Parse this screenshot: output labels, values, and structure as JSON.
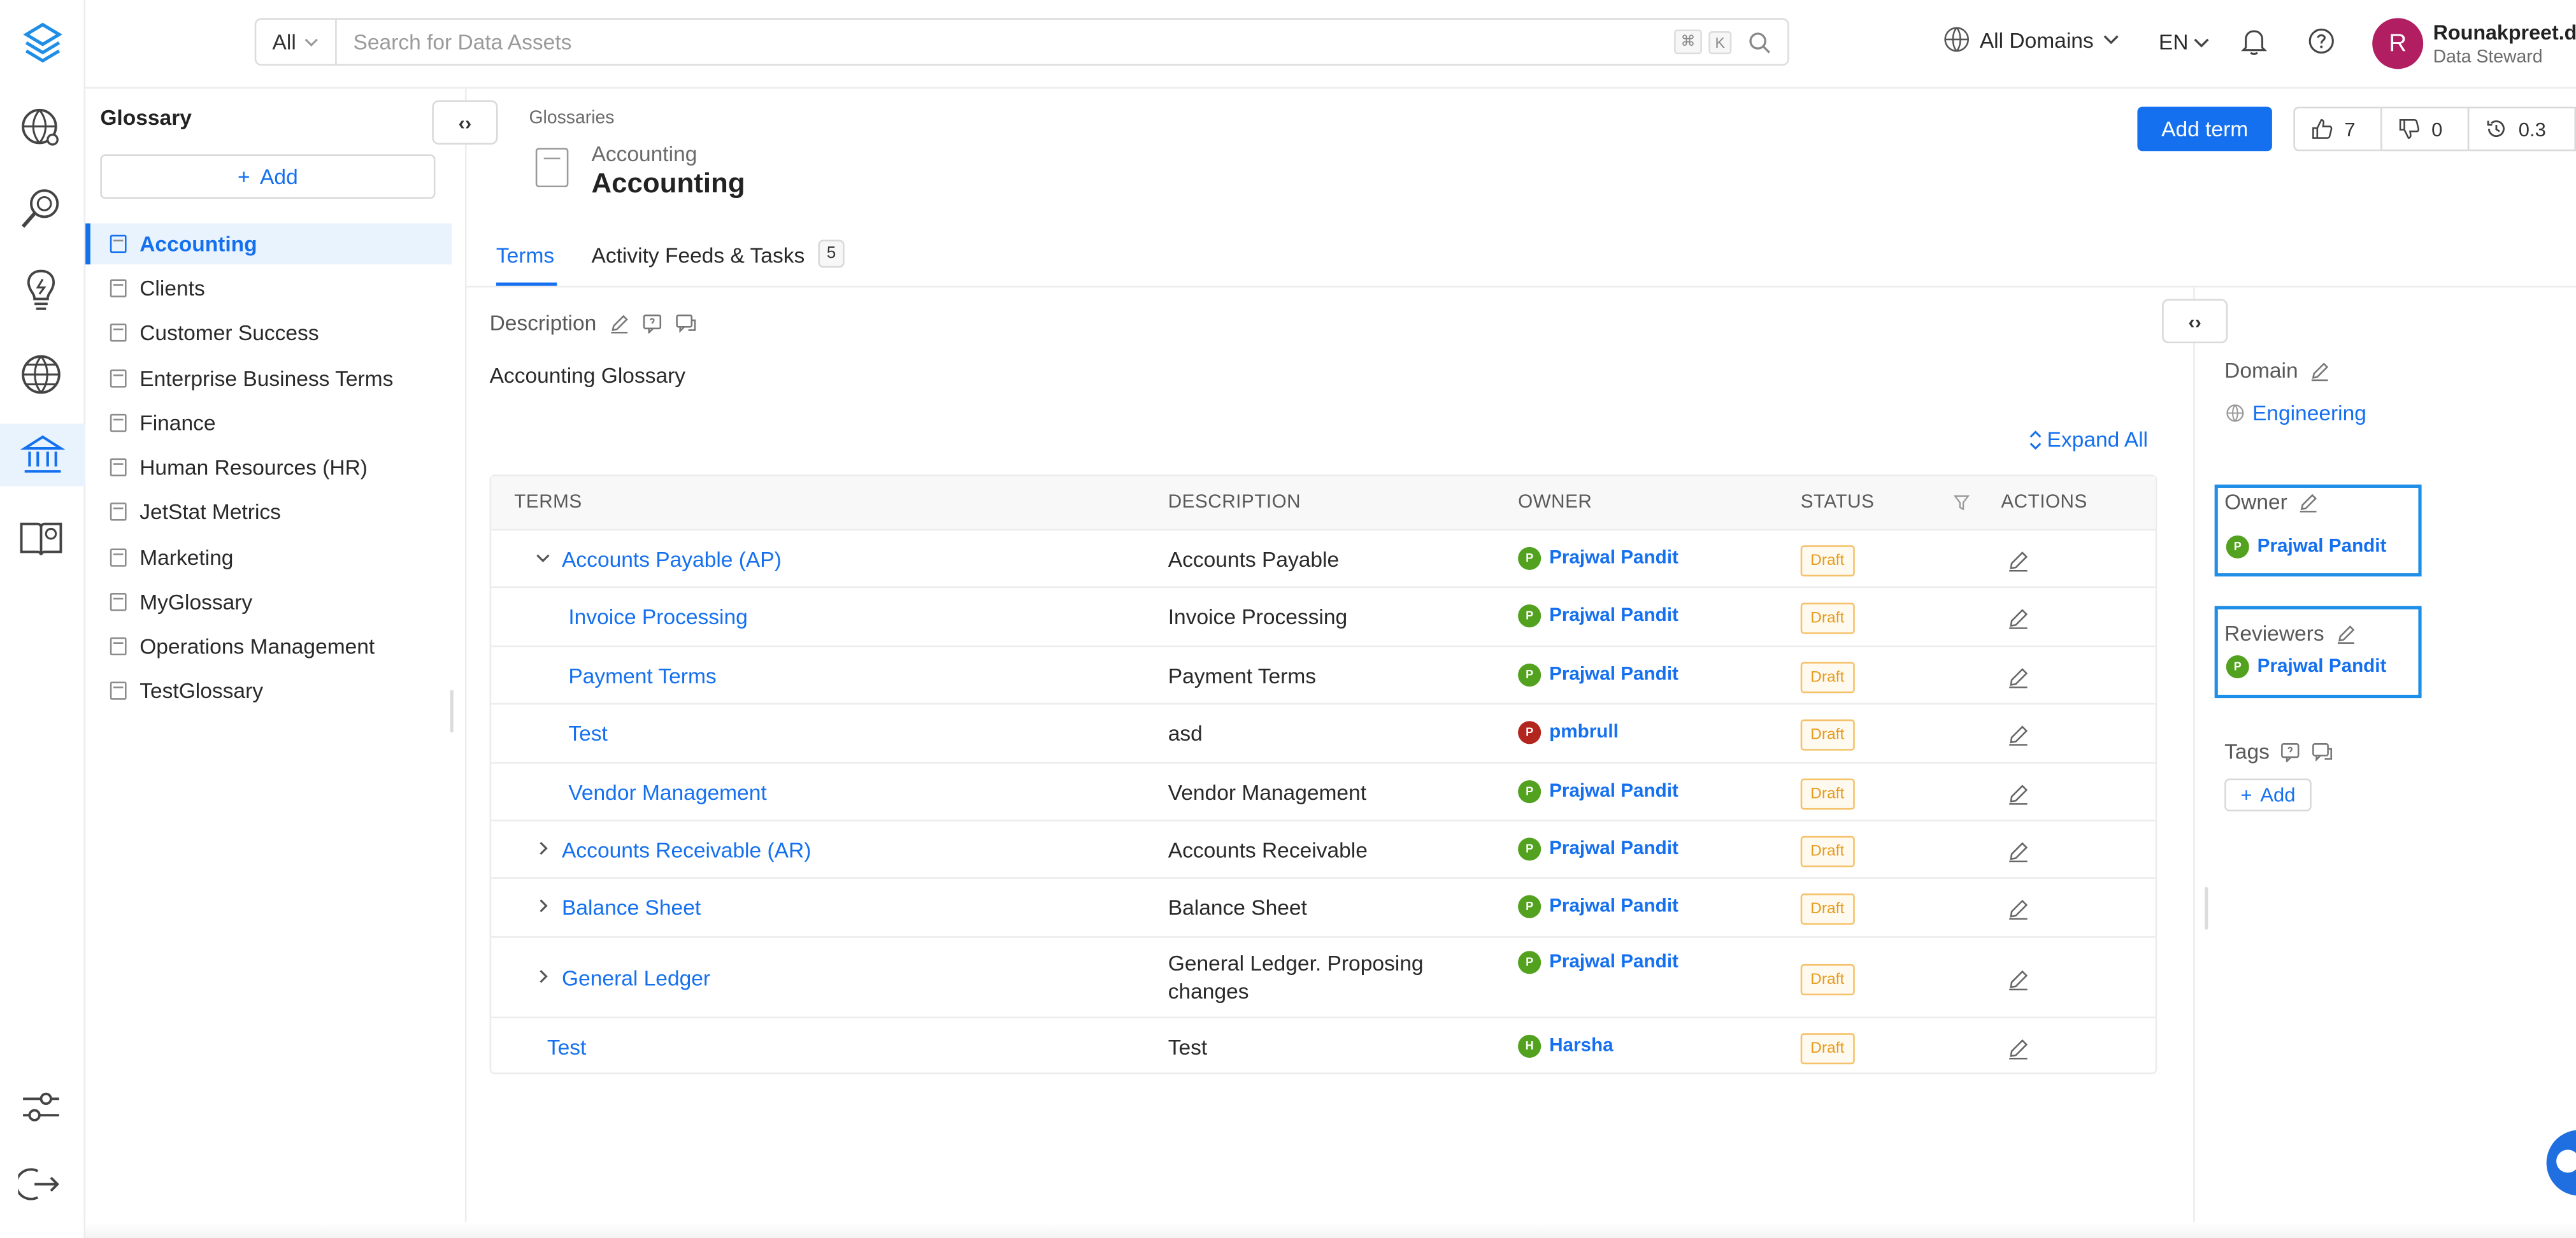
{
  "header": {
    "search_scope": "All",
    "search_placeholder": "Search for Data Assets",
    "shortcut_keys": [
      "⌘",
      "K"
    ],
    "domain_selector": "All Domains",
    "language": "EN",
    "user_initial": "R",
    "user_name": "Rounakpreet.d",
    "user_role": "Data Steward"
  },
  "sidebar": {
    "title": "Glossary",
    "add_label": "Add",
    "items": [
      {
        "label": "Accounting",
        "active": true
      },
      {
        "label": "Clients"
      },
      {
        "label": "Customer Success"
      },
      {
        "label": "Enterprise Business Terms"
      },
      {
        "label": "Finance"
      },
      {
        "label": "Human Resources (HR)"
      },
      {
        "label": "JetStat Metrics"
      },
      {
        "label": "Marketing"
      },
      {
        "label": "MyGlossary"
      },
      {
        "label": "Operations Management"
      },
      {
        "label": "TestGlossary"
      }
    ]
  },
  "page": {
    "breadcrumb": "Glossaries",
    "subtitle": "Accounting",
    "title": "Accounting",
    "add_term_label": "Add term",
    "upvotes": "7",
    "downvotes": "0",
    "version": "0.3"
  },
  "tabs": [
    {
      "label": "Terms",
      "active": true
    },
    {
      "label": "Activity Feeds & Tasks",
      "count": "5"
    }
  ],
  "description": {
    "heading": "Description",
    "text": "Accounting Glossary"
  },
  "expand_all_label": "Expand All",
  "table": {
    "headers": [
      "TERMS",
      "DESCRIPTION",
      "OWNER",
      "STATUS",
      "ACTIONS"
    ],
    "rows": [
      {
        "term": "Accounts Payable (AP)",
        "description": "Accounts Payable",
        "owner": "Prajwal Pandit",
        "owner_initial": "P",
        "status": "Draft",
        "expander": "expanded"
      },
      {
        "term": "Invoice Processing",
        "description": "Invoice Processing",
        "owner": "Prajwal Pandit",
        "owner_initial": "P",
        "status": "Draft"
      },
      {
        "term": "Payment Terms",
        "description": "Payment Terms",
        "owner": "Prajwal Pandit",
        "owner_initial": "P",
        "status": "Draft"
      },
      {
        "term": "Test",
        "description": "asd",
        "owner": "pmbrull",
        "owner_initial": "P",
        "status": "Draft"
      },
      {
        "term": "Vendor Management",
        "description": "Vendor Management",
        "owner": "Prajwal Pandit",
        "owner_initial": "P",
        "status": "Draft"
      },
      {
        "term": "Accounts Receivable (AR)",
        "description": "Accounts Receivable",
        "owner": "Prajwal Pandit",
        "owner_initial": "P",
        "status": "Draft",
        "expander": "collapsed"
      },
      {
        "term": "Balance Sheet",
        "description": "Balance Sheet",
        "owner": "Prajwal Pandit",
        "owner_initial": "P",
        "status": "Draft",
        "expander": "collapsed"
      },
      {
        "term": "General Ledger",
        "description": "General Ledger. Proposing changes",
        "owner": "Prajwal Pandit",
        "owner_initial": "P",
        "status": "Draft",
        "expander": "collapsed"
      },
      {
        "term": "Test",
        "description": "Test",
        "owner": "Harsha",
        "owner_initial": "H",
        "status": "Draft"
      }
    ]
  },
  "right_panel": {
    "domain_label": "Domain",
    "domain_value": "Engineering",
    "owner_label": "Owner",
    "owner_value": "Prajwal Pandit",
    "owner_initial": "P",
    "reviewers_label": "Reviewers",
    "reviewer_value": "Prajwal Pandit",
    "reviewer_initial": "P",
    "tags_label": "Tags",
    "tags_add_label": "Add"
  },
  "colors": {
    "accent": "#1570ef",
    "owner_green": "#52a11f",
    "owner_red": "#b3261e",
    "draft": "#e69b1c"
  }
}
